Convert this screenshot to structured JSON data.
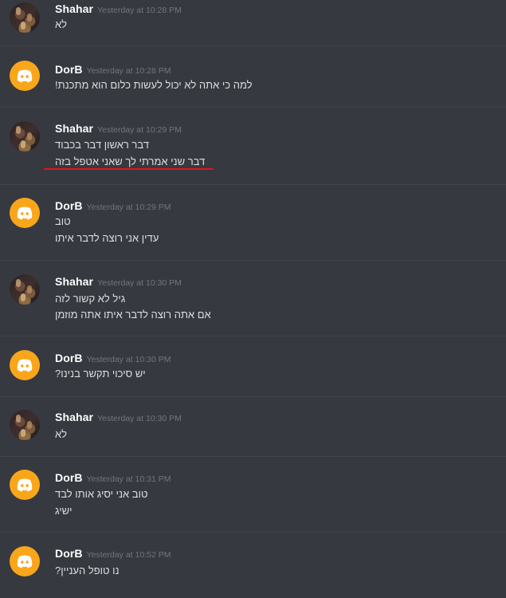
{
  "messages": [
    {
      "author": "Shahar",
      "timestamp": "Yesterday at 10:28 PM",
      "avatar": "user-photo-avatar",
      "lines": [
        "לא"
      ]
    },
    {
      "author": "DorB",
      "timestamp": "Yesterday at 10:28 PM",
      "avatar": "discord-logo-avatar",
      "lines": [
        "!למה כי אתה לא יכול לעשות כלום הוא מתכנת"
      ]
    },
    {
      "author": "Shahar",
      "timestamp": "Yesterday at 10:29 PM",
      "avatar": "user-photo-avatar",
      "lines": [
        "דבר ראשון דבר בכבוד",
        "דבר שני אמרתי לך שאני אטפל בזה"
      ]
    },
    {
      "author": "DorB",
      "timestamp": "Yesterday at 10:29 PM",
      "avatar": "discord-logo-avatar",
      "lines": [
        "טוב",
        "עדין אני רוצה לדבר איתו"
      ]
    },
    {
      "author": "Shahar",
      "timestamp": "Yesterday at 10:30 PM",
      "avatar": "user-photo-avatar",
      "lines": [
        "גיל לא קשור לזה",
        "אם אתה רוצה לדבר איתו אתה מוזמן"
      ]
    },
    {
      "author": "DorB",
      "timestamp": "Yesterday at 10:30 PM",
      "avatar": "discord-logo-avatar",
      "lines": [
        "?יש סיכוי תקשר בנינו"
      ]
    },
    {
      "author": "Shahar",
      "timestamp": "Yesterday at 10:30 PM",
      "avatar": "user-photo-avatar",
      "lines": [
        "לא"
      ]
    },
    {
      "author": "DorB",
      "timestamp": "Yesterday at 10:31 PM",
      "avatar": "discord-logo-avatar",
      "lines": [
        "טוב אני יסיג אותו לבד",
        "ישיג"
      ]
    },
    {
      "author": "DorB",
      "timestamp": "Yesterday at 10:52 PM",
      "avatar": "discord-logo-avatar",
      "lines": [
        "?נו טופל העניין"
      ]
    }
  ],
  "colors": {
    "background": "#36393f",
    "divider": "#40444b",
    "username": "#ffffff",
    "timestamp": "#72767d",
    "message_text": "#dcddde",
    "discord_avatar_bg": "#faa61a",
    "highlight_underline": "#e0141e"
  }
}
